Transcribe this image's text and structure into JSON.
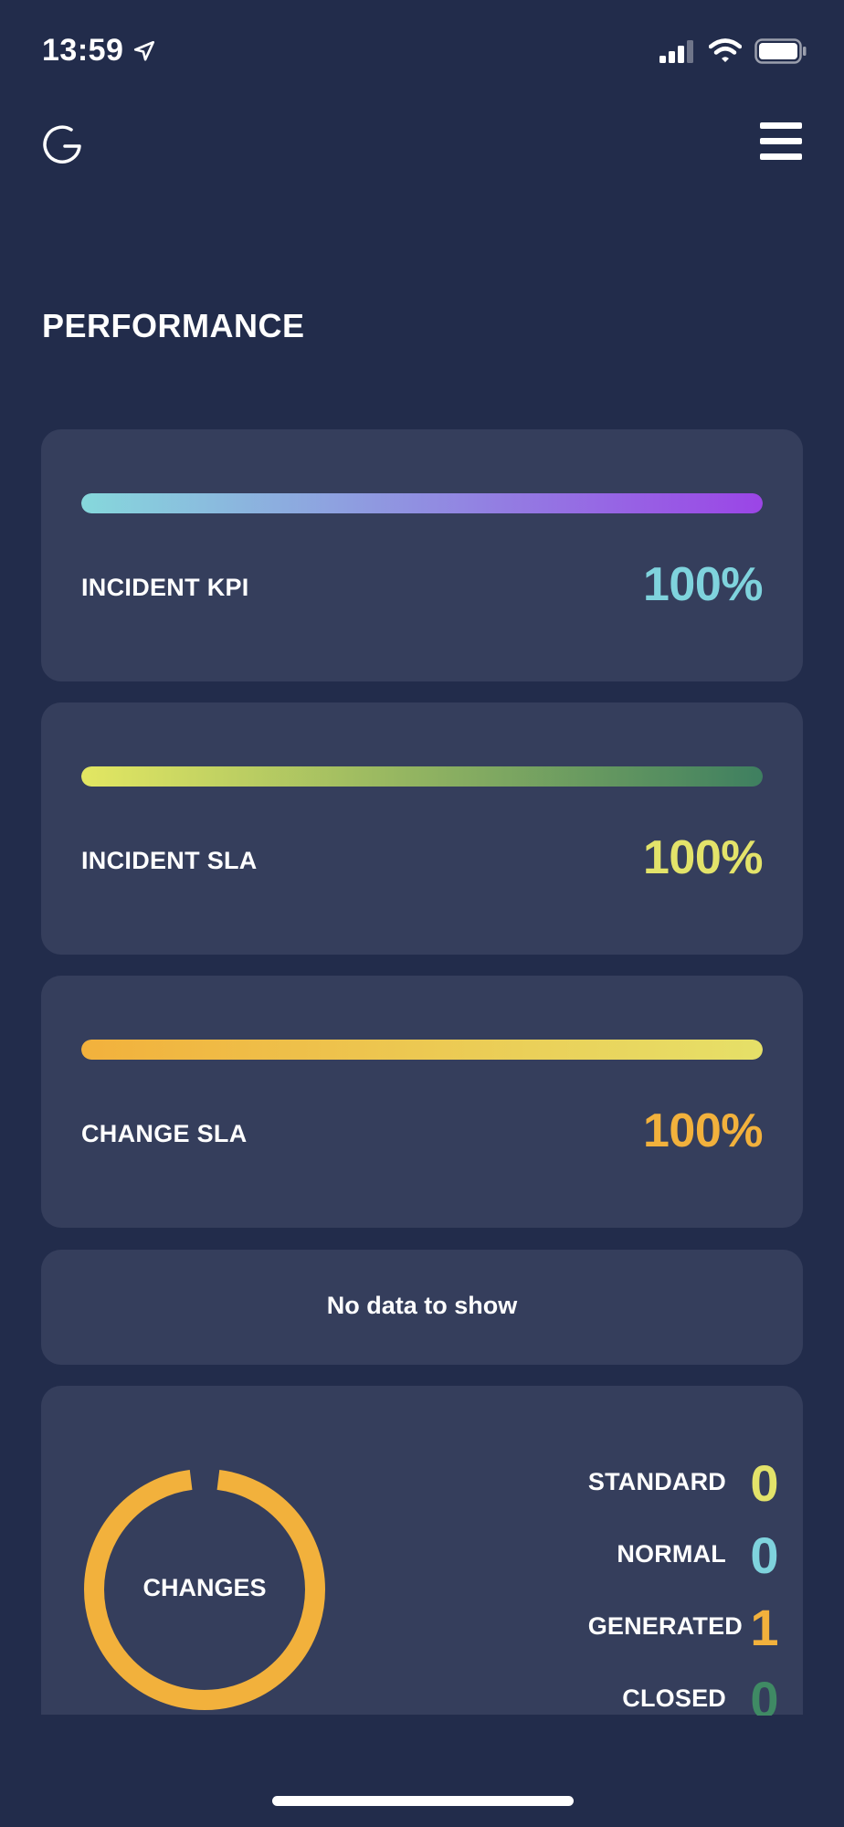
{
  "status_bar": {
    "time": "13:59",
    "location_icon": "location-arrow-icon",
    "signal_icon": "cellular-signal-icon",
    "wifi_icon": "wifi-icon",
    "battery_icon": "battery-icon"
  },
  "header": {
    "logo_icon": "app-logo-icon",
    "menu_icon": "hamburger-menu-icon"
  },
  "page_title": "PERFORMANCE",
  "kpis": [
    {
      "label": "INCIDENT KPI",
      "value": "100%",
      "progress": 1.0,
      "value_color": "#7fd3dd",
      "gradient": [
        "#86d8dc",
        "#9b45e6"
      ]
    },
    {
      "label": "INCIDENT SLA",
      "value": "100%",
      "progress": 1.0,
      "value_color": "#e3e36a",
      "gradient": [
        "#e3e762",
        "#3e7f60"
      ]
    },
    {
      "label": "CHANGE SLA",
      "value": "100%",
      "progress": 1.0,
      "value_color": "#f2b13c",
      "gradient": [
        "#f2b13c",
        "#e6e068"
      ]
    }
  ],
  "empty_message": "No data to show",
  "changes": {
    "title": "CHANGES",
    "ring_color": "#f2b13c",
    "legend": [
      {
        "label": "STANDARD",
        "value": "0",
        "color": "#e3e36a"
      },
      {
        "label": "NORMAL",
        "value": "0",
        "color": "#7fd3dd"
      },
      {
        "label": "GENERATED",
        "value": "1",
        "color": "#f2b13c"
      },
      {
        "label": "CLOSED",
        "value": "0",
        "color": "#3f8a64"
      }
    ]
  },
  "colors": {
    "background": "#222c4b",
    "card": "#353e5c"
  }
}
